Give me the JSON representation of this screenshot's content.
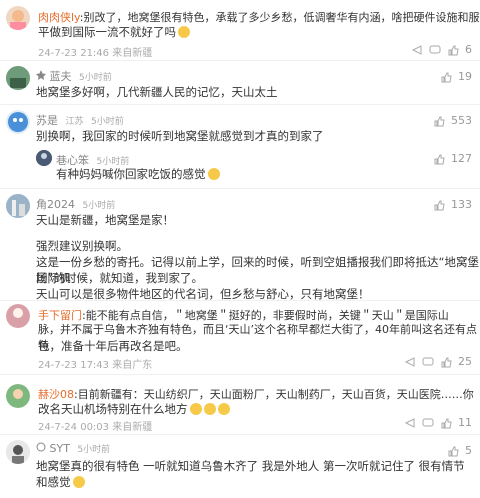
{
  "comments": [
    {
      "user": "肉肉侠ly",
      "text_line1": ":别改了，地窝堡很有特色，承载了多少乡愁，低调奢华有内涵，啥把硬件设施和服务水",
      "text_line2": "平做到国际一流不就好了吗",
      "meta": "24-7-23 21:46 来自新疆",
      "likes": "6"
    },
    {
      "user": "蓝夫",
      "time": "5小时前",
      "text": "地窝堡多好啊，几代新疆人民的记忆，天山太土",
      "likes": "19"
    },
    {
      "user": "苏是",
      "loc": "江苏",
      "time": "5小时前",
      "text": "别换啊，我回家的时候听到地窝堡就感觉到才真的到家了",
      "likes": "553",
      "reply": {
        "user": "巷心笨",
        "time": "5小时前",
        "text": "有种妈妈喊你回家吃饭的感觉",
        "likes": "127"
      }
    },
    {
      "user": "角2024",
      "time": "5小时前",
      "text1": "天山是新疆，地窝堡是家！",
      "text2": "强烈建议别换啊。",
      "text3": "这是一份乡愁的寄托。记得以前上学，回来的时候，听到空姐播报我们即将抵达“地窝堡国际机",
      "text4": "场”的时候，就知道，我到家了。",
      "text5": "天山可以是很多物件地区的代名词，但乡愁与舒心，只有地窝堡！",
      "likes": "133"
    },
    {
      "user": "手下留门",
      "text1": ":能不能有点自信，＂地窝堡＂挺好的，非要假时尚，关键＂天山＂是国际山",
      "text2": "脉，并不属于乌鲁木齐独有特色，而且‘天山’这个名称早都烂大街了，40年前叫这名还有点特",
      "text3": "色，准备十年后再改名是吧。",
      "meta": "24-7-23 17:43 来自广东",
      "likes": "25"
    },
    {
      "user": "赫沙08",
      "text1": ":目前新疆有：天山纺织厂，天山面粉厂，天山制药厂，天山百货，天山医院……你",
      "text2": "改名天山机场特别在什么地方",
      "meta": "24-7-24 00:03 来自新疆",
      "likes": "11"
    },
    {
      "user": "SYT",
      "time": "5小时前",
      "text": "地窝堡真的很有特色 一听就知道乌鲁木齐了 我是外地人 第一次听就记住了 很有情节和感觉",
      "likes": "5"
    }
  ],
  "colors": {
    "nick": "#e56c2a",
    "meta": "#aaaaaa",
    "text": "#333333"
  }
}
